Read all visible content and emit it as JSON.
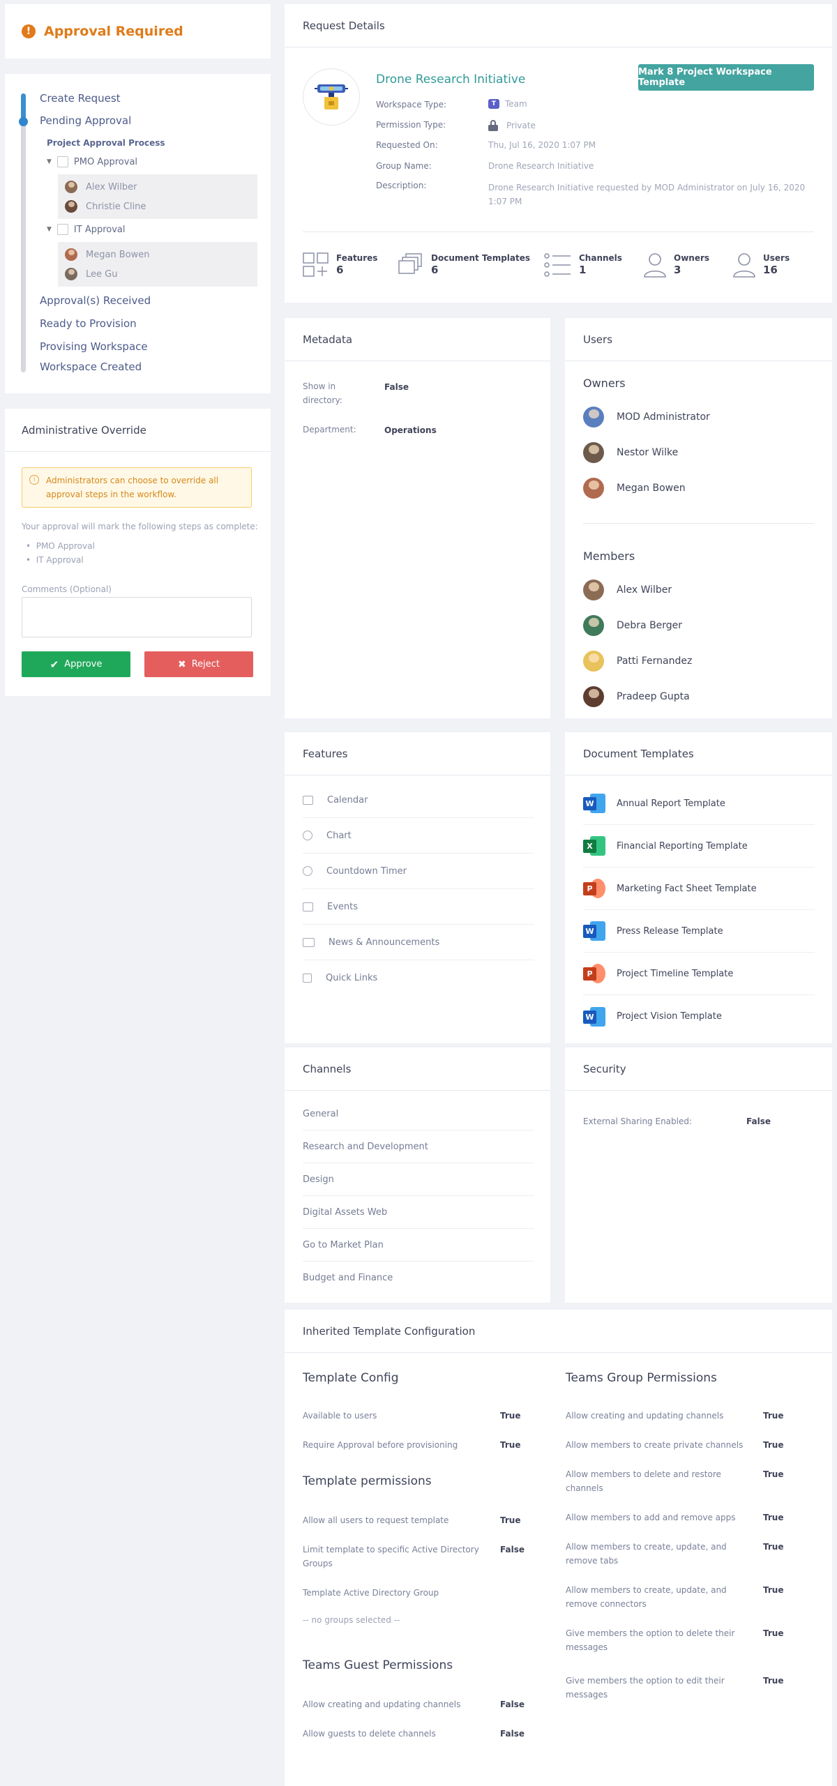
{
  "approval": {
    "title": "Approval Required"
  },
  "timeline": {
    "steps": [
      "Create Request",
      "Pending Approval",
      "Approval(s) Received",
      "Ready to Provision",
      "Provising Workspace",
      "Workspace Created"
    ],
    "process_title": "Project Approval Process",
    "branches": [
      {
        "name": "PMO Approval",
        "users": [
          "Alex Wilber",
          "Christie Cline"
        ]
      },
      {
        "name": "IT Approval",
        "users": [
          "Megan Bowen",
          "Lee Gu"
        ]
      }
    ]
  },
  "override": {
    "title": "Administrative Override",
    "alert": "Administrators can choose to override all approval steps in the workflow.",
    "note": "Your approval will mark the following steps as complete:",
    "steps": [
      "PMO Approval",
      "IT Approval"
    ],
    "comments_label": "Comments (Optional)",
    "approve_label": "Approve",
    "reject_label": "Reject"
  },
  "request": {
    "header": "Request Details",
    "project_title": "Drone Research Initiative",
    "mark_button": "Mark 8 Project Workspace Template",
    "fields": [
      {
        "label": "Workspace Type:",
        "value": "Team"
      },
      {
        "label": "Permission Type:",
        "value": "Private"
      },
      {
        "label": "Requested On:",
        "value": "Thu, Jul 16, 2020 1:07 PM"
      },
      {
        "label": "Group Name:",
        "value": "Drone Research Initiative"
      },
      {
        "label": "Description:",
        "value": "Drone Research Initiative requested by MOD Administrator on July 16, 2020 1:07 PM"
      }
    ],
    "stats": [
      {
        "label": "Features",
        "value": "6"
      },
      {
        "label": "Document Templates",
        "value": "6"
      },
      {
        "label": "Channels",
        "value": "1"
      },
      {
        "label": "Owners",
        "value": "3"
      },
      {
        "label": "Users",
        "value": "16"
      }
    ]
  },
  "metadata": {
    "header": "Metadata",
    "rows": [
      {
        "label": "Show in directory:",
        "value": "False"
      },
      {
        "label": "Department:",
        "value": "Operations"
      }
    ]
  },
  "users": {
    "header": "Users",
    "owners_title": "Owners",
    "owners": [
      "MOD Administrator",
      "Nestor Wilke",
      "Megan Bowen"
    ],
    "members_title": "Members",
    "members": [
      "Alex Wilber",
      "Debra Berger",
      "Patti Fernandez",
      "Pradeep Gupta"
    ]
  },
  "features": {
    "header": "Features",
    "items": [
      "Calendar",
      "Chart",
      "Countdown Timer",
      "Events",
      "News & Announcements",
      "Quick Links"
    ]
  },
  "doc_templates": {
    "header": "Document Templates",
    "items": [
      {
        "name": "Annual Report Template",
        "app": "W"
      },
      {
        "name": "Financial Reporting Template",
        "app": "X"
      },
      {
        "name": "Marketing Fact Sheet Template",
        "app": "P"
      },
      {
        "name": "Press Release Template",
        "app": "W"
      },
      {
        "name": "Project Timeline Template",
        "app": "P"
      },
      {
        "name": "Project Vision Template",
        "app": "W"
      }
    ]
  },
  "channels": {
    "header": "Channels",
    "items": [
      "General",
      "Research and Development",
      "Design",
      "Digital Assets Web",
      "Go to Market Plan",
      "Budget and Finance"
    ]
  },
  "security": {
    "header": "Security",
    "label": "External Sharing Enabled:",
    "value": "False"
  },
  "inherited": {
    "header": "Inherited Template Configuration",
    "template_config": {
      "title": "Template Config",
      "rows": [
        {
          "label": "Available to users",
          "value": "True"
        },
        {
          "label": "Require Approval before provisioning",
          "value": "True"
        }
      ]
    },
    "template_permissions": {
      "title": "Template permissions",
      "rows": [
        {
          "label": "Allow all users to request template",
          "value": "True"
        },
        {
          "label": "Limit template to specific Active Directory Groups",
          "value": "False"
        },
        {
          "label": "Template Active Directory Group",
          "value": ""
        }
      ],
      "no_groups": "-- no groups selected --"
    },
    "guest_permissions": {
      "title": "Teams Guest Permissions",
      "rows": [
        {
          "label": "Allow creating and updating channels",
          "value": "False"
        },
        {
          "label": "Allow guests to delete channels",
          "value": "False"
        }
      ]
    },
    "group_permissions": {
      "title": "Teams Group Permissions",
      "rows": [
        {
          "label": "Allow creating and updating channels",
          "value": "True"
        },
        {
          "label": "Allow members to create private channels",
          "value": "True"
        },
        {
          "label": "Allow members to delete and restore channels",
          "value": "True"
        },
        {
          "label": "Allow members to add and remove apps",
          "value": "True"
        },
        {
          "label": "Allow members to create, update, and remove tabs",
          "value": "True"
        },
        {
          "label": "Allow members to create, update, and remove connectors",
          "value": "True"
        },
        {
          "label": "Give members the option to delete their messages",
          "value": "True"
        },
        {
          "label": "Give members the option to edit their messages",
          "value": "True"
        }
      ]
    }
  },
  "colors": {
    "accent": "#43a4a0",
    "approve": "#20a85a",
    "reject": "#e45e5e",
    "warning": "#e07b19",
    "timeline": "#3b8fd1"
  }
}
